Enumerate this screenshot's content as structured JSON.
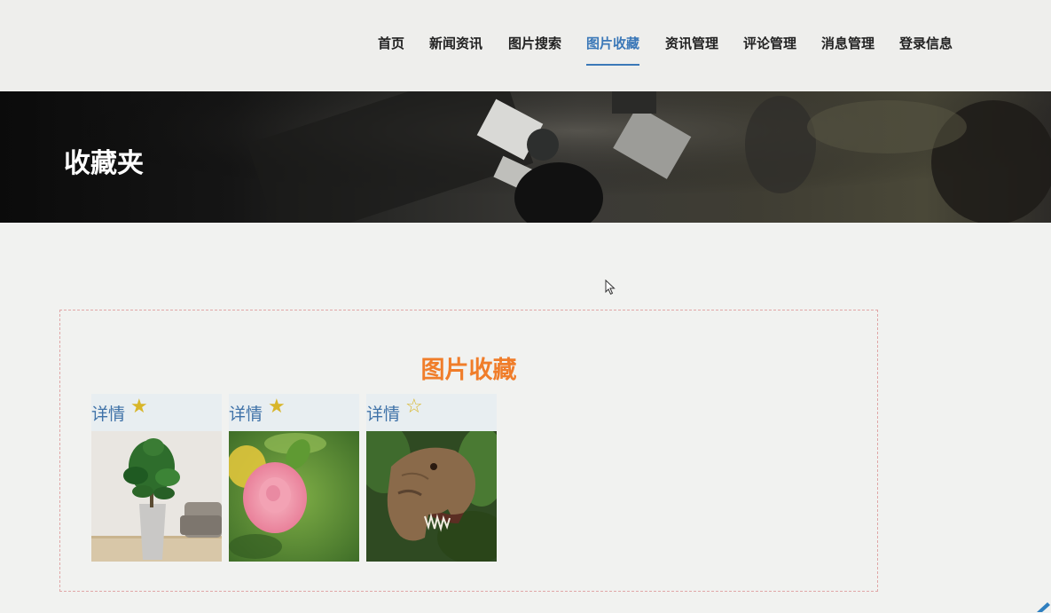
{
  "nav": {
    "items": [
      {
        "label": "首页",
        "name": "nav-home"
      },
      {
        "label": "新闻资讯",
        "name": "nav-news"
      },
      {
        "label": "图片搜索",
        "name": "nav-image-search"
      },
      {
        "label": "图片收藏",
        "name": "nav-image-favorites"
      },
      {
        "label": "资讯管理",
        "name": "nav-news-management"
      },
      {
        "label": "评论管理",
        "name": "nav-comment-management"
      },
      {
        "label": "消息管理",
        "name": "nav-message-management"
      },
      {
        "label": "登录信息",
        "name": "nav-login-info"
      }
    ],
    "active_index": 3,
    "accent_color": "#3b78b8"
  },
  "banner": {
    "title": "收藏夹"
  },
  "favorites": {
    "title": "图片收藏",
    "title_color": "#f07d2a",
    "items": [
      {
        "detail_label": "详情",
        "star": "★",
        "starred": true,
        "image": "potted-plant-image"
      },
      {
        "detail_label": "详情",
        "star": "★",
        "starred": true,
        "image": "pink-camellia-image"
      },
      {
        "detail_label": "详情",
        "star": "☆",
        "starred": false,
        "image": "dinosaur-head-image"
      }
    ]
  }
}
